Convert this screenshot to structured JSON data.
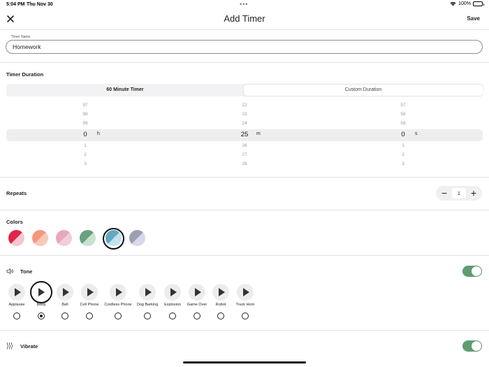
{
  "status_bar": {
    "time": "5:04 PM",
    "date": "Thu Nov 30",
    "dots": "•••",
    "battery": "100%"
  },
  "nav": {
    "title": "Add Timer",
    "save_label": "Save",
    "close_icon": "close-icon"
  },
  "timer_name": {
    "label": "Timer Name",
    "value": "Homework"
  },
  "duration": {
    "section_label": "Timer Duration",
    "tabs": [
      "60 Minute Timer",
      "Custom Duration"
    ],
    "hours": {
      "values": [
        "97",
        "98",
        "99",
        "0",
        "1",
        "2",
        "3"
      ],
      "unit": "h"
    },
    "minutes": {
      "values": [
        "22",
        "23",
        "24",
        "25",
        "26",
        "27",
        "28"
      ],
      "unit": "m"
    },
    "seconds": {
      "values": [
        "57",
        "58",
        "59",
        "0",
        "1",
        "2",
        "3"
      ],
      "unit": "s"
    }
  },
  "repeats": {
    "label": "Repeats",
    "minus": "−",
    "value": "1",
    "plus": "+"
  },
  "colors": {
    "label": "Colors",
    "swatches": [
      {
        "a": "#e2234a",
        "b": "#f4c7d0"
      },
      {
        "a": "#f4987c",
        "b": "#f8c9b7"
      },
      {
        "a": "#e8a8bc",
        "b": "#f1cfd8"
      },
      {
        "a": "#6aa07c",
        "b": "#c7e3ce"
      },
      {
        "a": "#63a8c3",
        "b": "#bfe2ee"
      },
      {
        "a": "#9b9fb0",
        "b": "#d8d7ec"
      }
    ],
    "selected_index": 4
  },
  "tone": {
    "label": "Tone",
    "icon": "speaker-icon",
    "enabled": true,
    "toggle_color": "#5f9c72",
    "items": [
      "Applause",
      "Beep",
      "Bell",
      "Cell Phone",
      "Cordless Phone",
      "Dog Barking",
      "Explosion",
      "Game Over",
      "Robot",
      "Truck Horn"
    ],
    "selected_index": 1
  },
  "vibrate": {
    "label": "Vibrate",
    "icon": "vibrate-icon",
    "enabled": true
  }
}
